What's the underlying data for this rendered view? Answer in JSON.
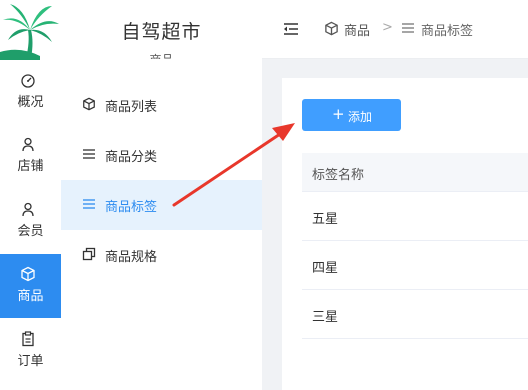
{
  "rail": {
    "items": [
      {
        "label": "概况",
        "icon": "dashboard-icon"
      },
      {
        "label": "店铺",
        "icon": "store-icon"
      },
      {
        "label": "会员",
        "icon": "member-icon"
      },
      {
        "label": "商品",
        "icon": "goods-icon",
        "active": true
      },
      {
        "label": "订单",
        "icon": "order-icon"
      }
    ]
  },
  "brand": {
    "title": "自驾超市",
    "section": "商品"
  },
  "submenu": {
    "items": [
      {
        "label": "商品列表",
        "icon": "cube-icon"
      },
      {
        "label": "商品分类",
        "icon": "list-icon"
      },
      {
        "label": "商品标签",
        "icon": "list-icon",
        "active": true
      },
      {
        "label": "商品规格",
        "icon": "copy-icon"
      }
    ]
  },
  "header": {
    "breadcrumb": {
      "root": "商品",
      "separator": ">",
      "current": "商品标签"
    }
  },
  "toolbar": {
    "add_plus": "+",
    "add_label": "添加"
  },
  "table": {
    "header": "标签名称",
    "rows": [
      "五星",
      "四星",
      "三星"
    ]
  },
  "colors": {
    "accent": "#2d8cf0",
    "button": "#409eff",
    "annotation_arrow": "#e8372b"
  }
}
